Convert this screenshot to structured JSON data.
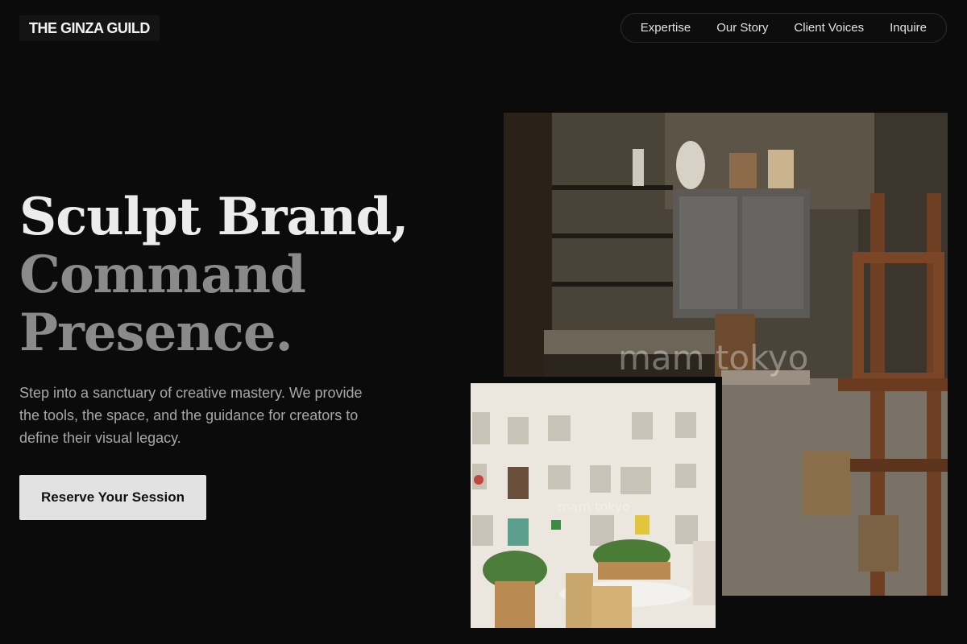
{
  "brand": {
    "name": "THE GINZA GUILD"
  },
  "nav": {
    "items": [
      {
        "label": "Expertise"
      },
      {
        "label": "Our Story"
      },
      {
        "label": "Client Voices"
      },
      {
        "label": "Inquire"
      }
    ]
  },
  "hero": {
    "headline": {
      "line1": "Sculpt Brand,",
      "line2": "Command",
      "line3": "Presence."
    },
    "lede": "Step into a sanctuary of creative mastery. We provide the tools, the space, and the guidance for creators to define their visual legacy.",
    "cta_label": "Reserve Your Session"
  },
  "images": {
    "large_watermark": "mam tokyo",
    "small_watermark": "mam tokyo"
  },
  "colors": {
    "background": "#0b0b0b",
    "headline_primary": "#ececec",
    "headline_secondary": "#8a8a8a",
    "cta_bg": "#e2e2e2"
  }
}
